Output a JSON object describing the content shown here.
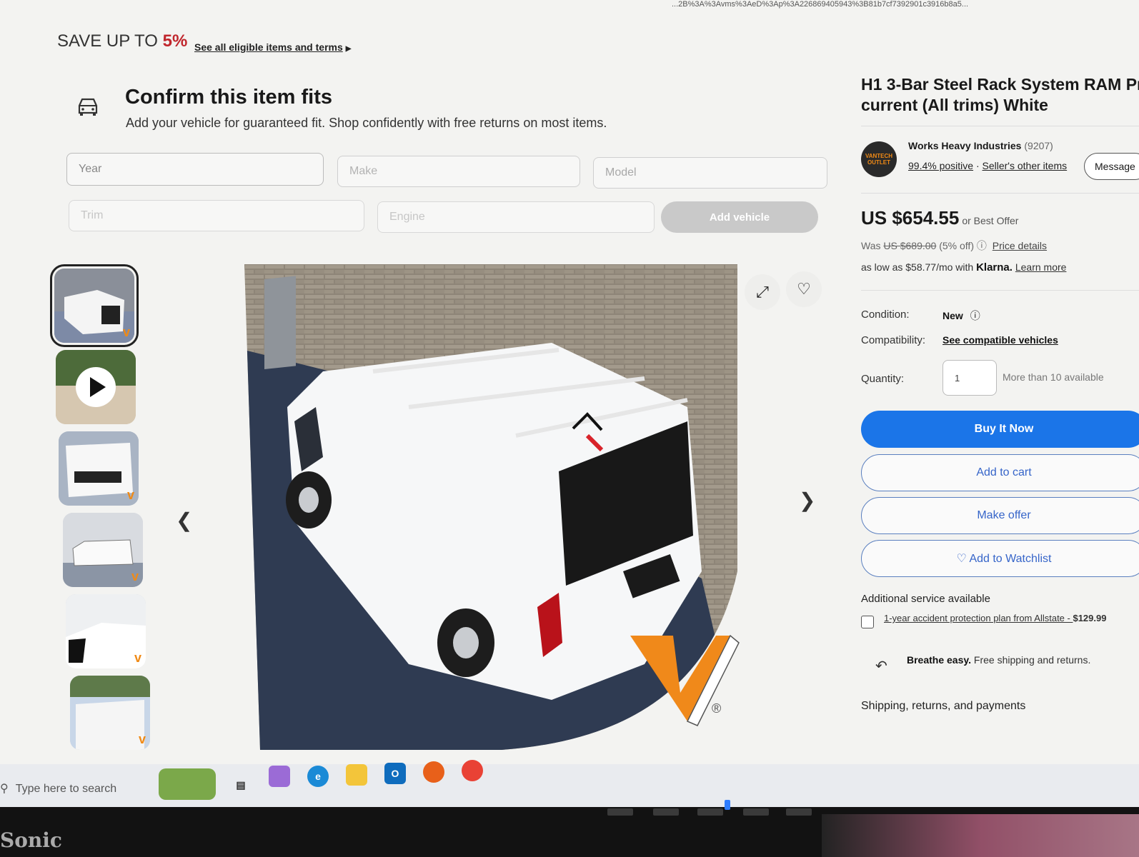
{
  "browser": {
    "url_fragment": "...2B%3A%3Avms%3AeD%3Ap%3A226869405943%3B81b7cf7392901c3916b8a5..."
  },
  "promo": {
    "prefix": "SAVE UP TO",
    "percent": "5%",
    "link": "See all eligible items and terms"
  },
  "fitment": {
    "title": "Confirm this item fits",
    "subtitle": "Add your vehicle for guaranteed fit. Shop confidently with free returns on most items.",
    "fields": {
      "year": "Year",
      "make": "Make",
      "model": "Model",
      "trim": "Trim",
      "engine": "Engine"
    },
    "add_button": "Add vehicle"
  },
  "gallery": {
    "thumbnails": [
      "van-rear-view",
      "video",
      "van-top-rear",
      "van-side",
      "van-roof-closeup",
      "van-outdoor"
    ],
    "selected_index": 0,
    "badge_glyph": "v",
    "play_icon": "play-icon",
    "trademark": "®"
  },
  "listing": {
    "title_line1": "H1 3-Bar Steel Rack System RAM Pr",
    "title_line2": "current (All trims) White",
    "seller": {
      "name": "Works Heavy Industries",
      "count": "(9207)",
      "positive": "99.4% positive",
      "other_items": "Seller's other items",
      "message": "Message",
      "logo_text": "VANTECH OUTLET"
    },
    "price": "US $654.55",
    "best_offer": "or Best Offer",
    "was_label": "Was",
    "was_price": "US $689.00",
    "discount": "(5% off)",
    "price_details": "Price details",
    "klarna_prefix": "as low as $58.77/mo with",
    "klarna_brand": "Klarna.",
    "learn_more": "Learn more",
    "condition_label": "Condition:",
    "condition_value": "New",
    "compat_label": "Compatibility:",
    "compat_value": "See compatible vehicles",
    "qty_label": "Quantity:",
    "qty_value": "1",
    "availability": "More than 10 available",
    "buy_now": "Buy It Now",
    "add_to_cart": "Add to cart",
    "make_offer": "Make offer",
    "watchlist": "♡ Add to Watchlist",
    "additional_service": "Additional service available",
    "protection_plan": "1-year accident protection plan from Allstate - ",
    "protection_price": "$129.99",
    "breathe_bold": "Breathe easy.",
    "breathe_text": " Free shipping and returns.",
    "shipping_heading": "Shipping, returns, and payments"
  },
  "taskbar": {
    "search_placeholder": "Type here to search",
    "apps": [
      "widgets",
      "task-view",
      "copilot",
      "edge",
      "file-explorer",
      "outlook",
      "firefox",
      "chrome"
    ]
  },
  "monitor": {
    "brand": "Sonic"
  },
  "colors": {
    "accent_blue": "#1b75e8",
    "sale_red": "#c0262d",
    "brand_orange": "#f08a16"
  }
}
